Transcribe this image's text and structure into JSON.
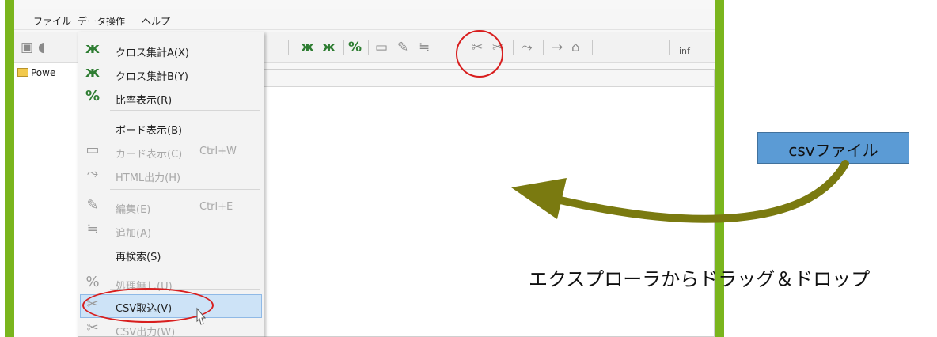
{
  "menubar": {
    "file": "ファイル",
    "data_ops": "データ操作",
    "help": "ヘルプ"
  },
  "toolbar": {
    "inf_label": "inf"
  },
  "tree": {
    "root_label": "Powe"
  },
  "dropdown": {
    "items": [
      {
        "icon": "cross-tab-a-icon",
        "glyph": "ж",
        "label": "クロス集計A(X)",
        "shortcut": "",
        "enabled": true
      },
      {
        "icon": "cross-tab-b-icon",
        "glyph": "ж",
        "label": "クロス集計B(Y)",
        "shortcut": "",
        "enabled": true
      },
      {
        "icon": "ratio-icon",
        "glyph": "%",
        "label": "比率表示(R)",
        "shortcut": "",
        "enabled": true
      },
      {
        "icon": "",
        "glyph": "",
        "label": "ボード表示(B)",
        "shortcut": "",
        "enabled": true
      },
      {
        "icon": "card-icon",
        "glyph": "▭",
        "label": "カード表示(C)",
        "shortcut": "Ctrl+W",
        "enabled": false
      },
      {
        "icon": "html-output-icon",
        "glyph": "⤳",
        "label": "HTML出力(H)",
        "shortcut": "",
        "enabled": false
      },
      {
        "icon": "edit-icon",
        "glyph": "✎",
        "label": "編集(E)",
        "shortcut": "Ctrl+E",
        "enabled": false
      },
      {
        "icon": "add-icon",
        "glyph": "≒",
        "label": "追加(A)",
        "shortcut": "",
        "enabled": false
      },
      {
        "icon": "",
        "glyph": "",
        "label": "再検索(S)",
        "shortcut": "",
        "enabled": true
      },
      {
        "icon": "no-process-icon",
        "glyph": "%",
        "label": "処理無し(U)",
        "shortcut": "",
        "enabled": false
      },
      {
        "icon": "csv-import-icon",
        "glyph": "✂",
        "label": "CSV取込(V)",
        "shortcut": "",
        "enabled": true
      },
      {
        "icon": "csv-export-icon",
        "glyph": "✂",
        "label": "CSV出力(W)",
        "shortcut": "",
        "enabled": false
      }
    ]
  },
  "annotations": {
    "csv_file_label": "csvファイル",
    "caption": "エクスプローラからドラッグ＆ドロップ"
  },
  "colors": {
    "accent_green": "#7ab51d",
    "highlight_red": "#d81e1e",
    "label_blue": "#5b9bd5",
    "arrow_olive": "#7a7a10",
    "menu_selected": "#cde3f7"
  }
}
